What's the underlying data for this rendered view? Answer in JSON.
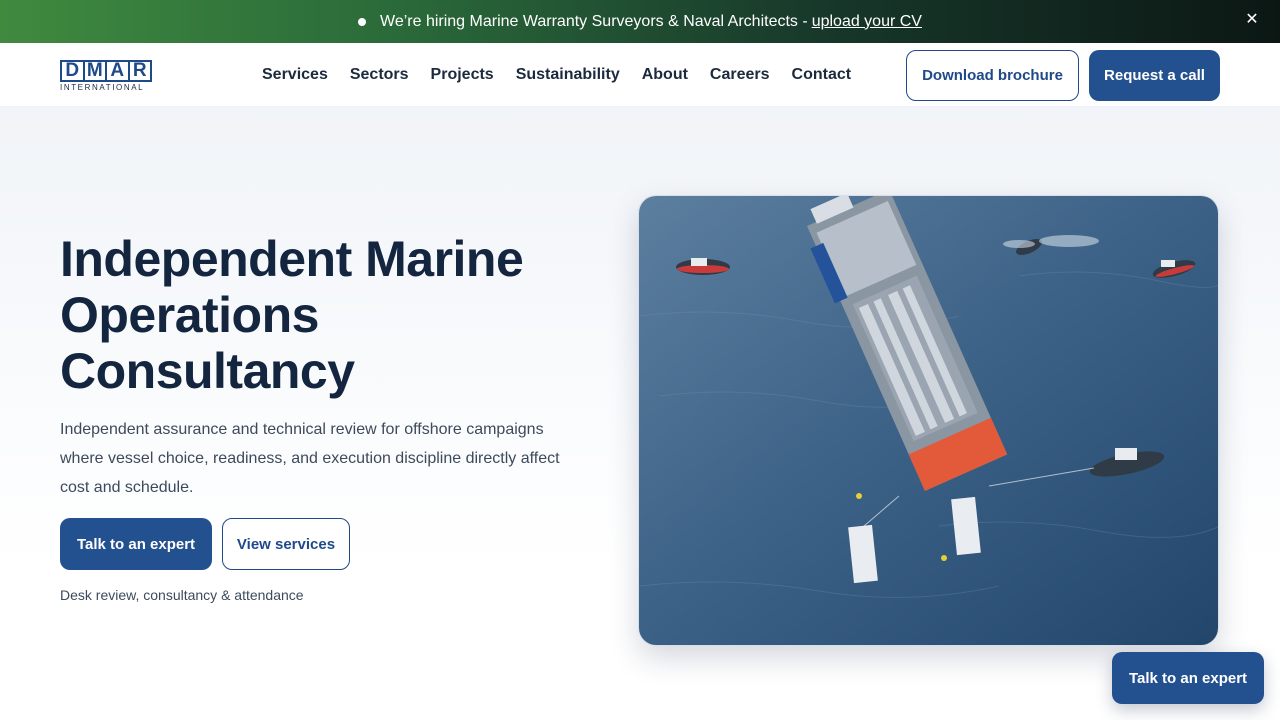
{
  "announcement": {
    "text": "We’re hiring Marine Warranty Surveyors & Naval Architects -",
    "link": "upload your CV",
    "close_glyph": "✕"
  },
  "logo": {
    "letters": [
      "D",
      "M",
      "A",
      "R"
    ],
    "subtitle": "INTERNATIONAL",
    "color": "#1f4a8a"
  },
  "nav": {
    "items": [
      "Services",
      "Sectors",
      "Projects",
      "Sustainability",
      "About",
      "Careers",
      "Contact"
    ]
  },
  "header_actions": {
    "download": "Download brochure",
    "request": "Request a call"
  },
  "hero": {
    "title": "Independent Marine Operations Consultancy",
    "lead": "Independent assurance and technical review for offshore campaigns where vessel choice, readiness, and execution discipline directly affect cost and schedule.",
    "primary_cta": "Talk to an expert",
    "secondary_cta": "View services",
    "note": "Desk review, consultancy & attendance",
    "image_subject": "aerial-offshore-vessel-with-tugs"
  },
  "floating_cta": "Talk to an expert",
  "colors": {
    "brand_blue": "#23508f",
    "heading": "#13253f",
    "banner_green": "#3f8a3f"
  }
}
